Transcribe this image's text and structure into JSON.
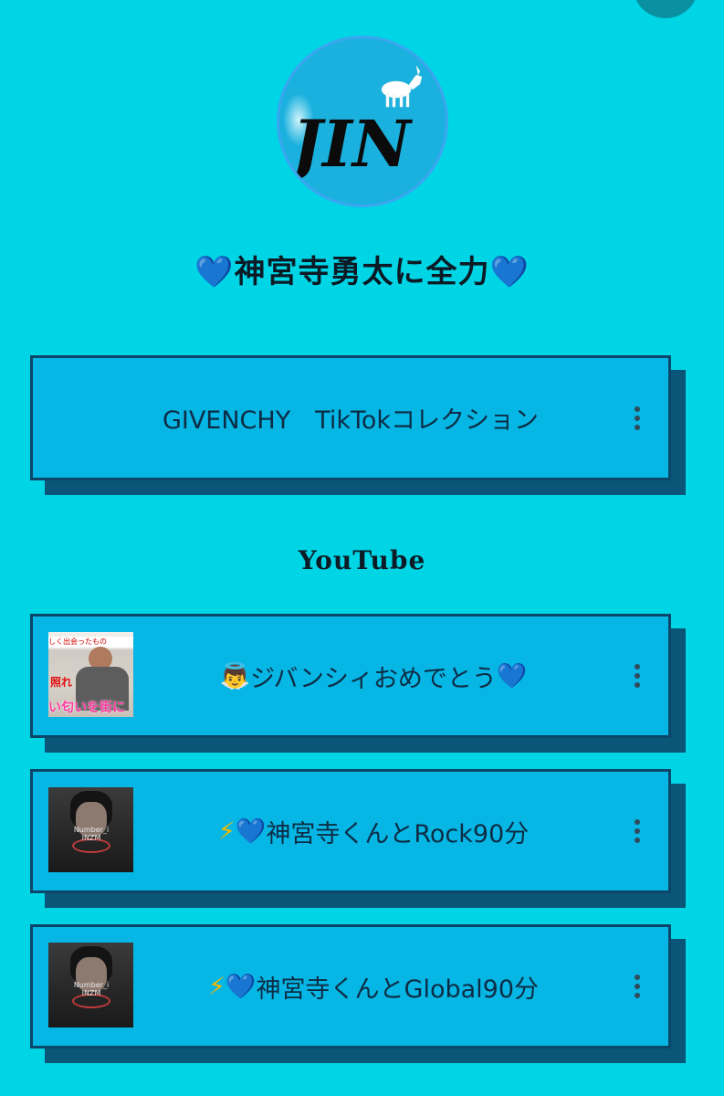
{
  "profile": {
    "avatar_logo_text": "JIN",
    "title_heart_left": "💙",
    "title_text": "神宮寺勇太に全力",
    "title_heart_right": "💙"
  },
  "links": {
    "top_link": {
      "label": "GIVENCHY　TikTokコレクション"
    },
    "section_title": "YouTube",
    "video_links": [
      {
        "emoji": "👼",
        "label": "ジバンシィおめでとう",
        "trail_emoji": "💙",
        "thumb_caption_top": "しく出会ったもの",
        "thumb_caption_mid": "照れ",
        "thumb_caption_bottom": "い匂いを街に"
      },
      {
        "emoji": "⚡",
        "emoji2": "💙",
        "label": "神宮寺くんとRock90分",
        "thumb_caption": "Number_i INZM"
      },
      {
        "emoji": "⚡",
        "emoji2": "💙",
        "label": "神宮寺くんとGlobal90分",
        "thumb_caption": "Number_i INZM"
      }
    ]
  },
  "colors": {
    "background": "#00d5e6",
    "card_fill": "#06b6e5",
    "card_border": "#0a4668",
    "card_shadow": "#0a5678",
    "heart": "#1e7ef0"
  },
  "icons": {
    "menu": "kebab-menu-icon",
    "share": "share-button"
  }
}
